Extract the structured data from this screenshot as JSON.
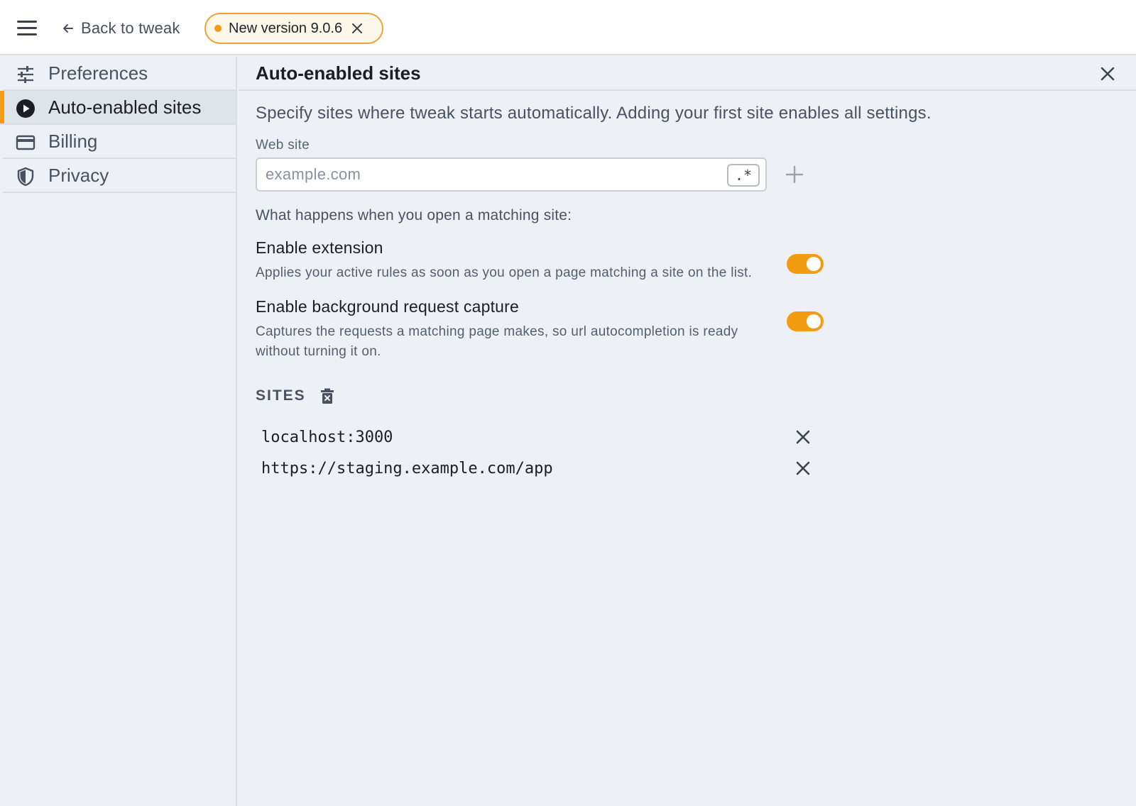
{
  "topbar": {
    "menu_icon": "hamburger-menu-icon",
    "back_label": "Back to tweak",
    "version_label": "New version 9.0.6"
  },
  "sidebar": {
    "items": [
      {
        "label": "Preferences",
        "icon": "sliders-icon",
        "active": false
      },
      {
        "label": "Auto-enabled sites",
        "icon": "play-circle-icon",
        "active": true
      },
      {
        "label": "Billing",
        "icon": "credit-card-icon",
        "active": false
      },
      {
        "label": "Privacy",
        "icon": "shield-icon",
        "active": false
      }
    ]
  },
  "main": {
    "title": "Auto-enabled sites",
    "intro": "Specify sites where tweak starts automatically. Adding your first site enables all settings.",
    "web_site_label": "Web site",
    "web_site_placeholder": "example.com",
    "web_site_value": "",
    "regex_label": ".*",
    "matching_note": "What happens when you open a matching site:",
    "options": [
      {
        "title": "Enable extension",
        "description": "Applies your active rules as soon as you open a page matching a site on the list.",
        "enabled": true
      },
      {
        "title": "Enable background request capture",
        "description": "Captures the requests a matching page makes, so url autocompletion is ready without turning it on.",
        "enabled": true
      }
    ],
    "sites_title": "SITES",
    "sites": [
      "localhost:3000",
      "https://staging.example.com/app"
    ]
  },
  "colors": {
    "accent": "#f39c12",
    "background": "#edf1f5",
    "topbar": "#ffffff"
  }
}
